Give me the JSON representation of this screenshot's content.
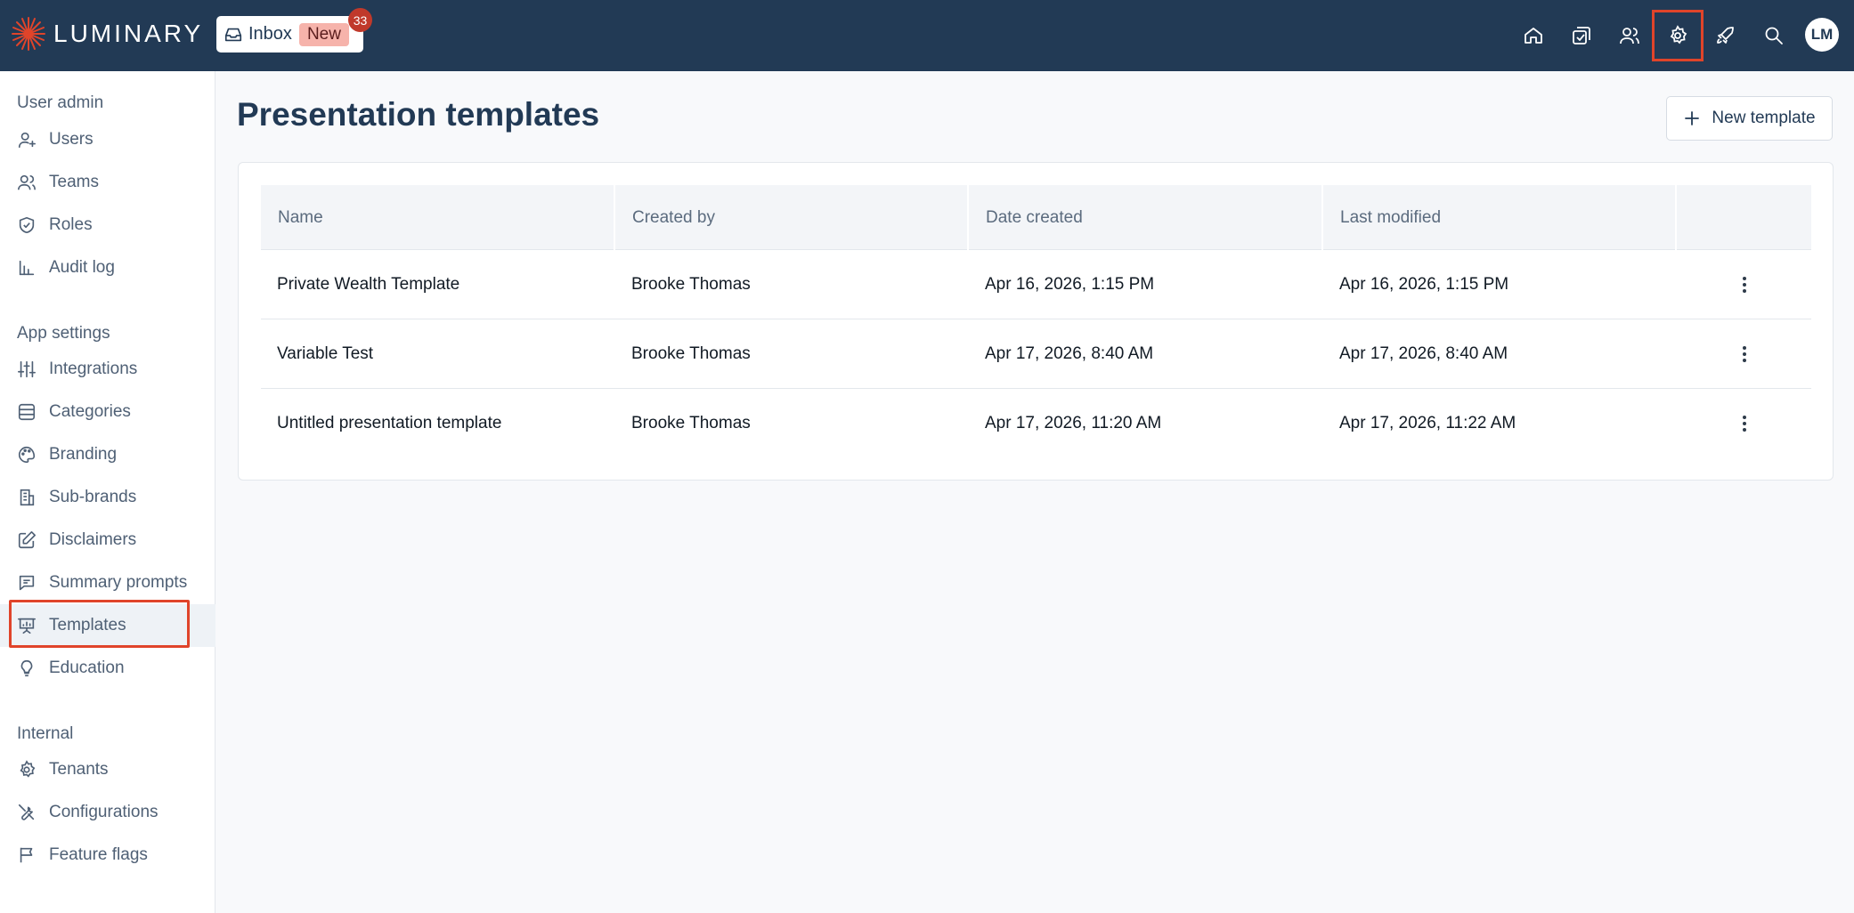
{
  "brand": {
    "name": "LUMINARY",
    "accent": "#e0442a",
    "bar_color": "#223a55"
  },
  "header": {
    "inbox_label": "Inbox",
    "inbox_new": "New",
    "inbox_count": "33",
    "nav_icons": [
      "home-icon",
      "tasks-icon",
      "people-icon",
      "settings-icon",
      "rocket-icon",
      "search-icon"
    ],
    "active_icon": "settings-icon",
    "avatar_initials": "LM"
  },
  "sidebar": {
    "sections": [
      {
        "title": "User admin",
        "items": [
          {
            "label": "Users",
            "icon": "user-plus-icon"
          },
          {
            "label": "Teams",
            "icon": "users-icon"
          },
          {
            "label": "Roles",
            "icon": "shield-check-icon"
          },
          {
            "label": "Audit log",
            "icon": "bar-chart-icon"
          }
        ]
      },
      {
        "title": "App settings",
        "items": [
          {
            "label": "Integrations",
            "icon": "sliders-icon"
          },
          {
            "label": "Categories",
            "icon": "database-icon"
          },
          {
            "label": "Branding",
            "icon": "palette-icon"
          },
          {
            "label": "Sub-brands",
            "icon": "building-icon"
          },
          {
            "label": "Disclaimers",
            "icon": "edit-icon"
          },
          {
            "label": "Summary prompts",
            "icon": "message-icon"
          },
          {
            "label": "Templates",
            "icon": "presentation-icon",
            "active": true
          },
          {
            "label": "Education",
            "icon": "lightbulb-icon"
          }
        ]
      },
      {
        "title": "Internal",
        "items": [
          {
            "label": "Tenants",
            "icon": "gear-icon"
          },
          {
            "label": "Configurations",
            "icon": "tools-icon"
          },
          {
            "label": "Feature flags",
            "icon": "flag-icon"
          }
        ]
      }
    ]
  },
  "main": {
    "title": "Presentation templates",
    "new_button_label": "New template",
    "table": {
      "columns": [
        "Name",
        "Created by",
        "Date created",
        "Last modified",
        ""
      ],
      "rows": [
        [
          "Private Wealth Template",
          "Brooke Thomas",
          "Apr 16, 2026, 1:15 PM",
          "Apr 16, 2026, 1:15 PM"
        ],
        [
          "Variable Test",
          "Brooke Thomas",
          "Apr 17, 2026, 8:40 AM",
          "Apr 17, 2026, 8:40 AM"
        ],
        [
          "Untitled presentation template",
          "Brooke Thomas",
          "Apr 17, 2026, 11:20 AM",
          "Apr 17, 2026, 11:22 AM"
        ]
      ]
    }
  }
}
